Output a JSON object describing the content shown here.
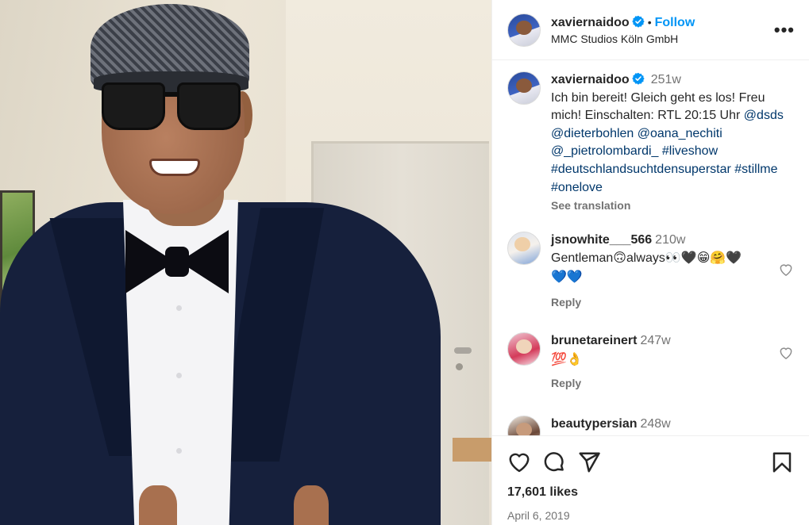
{
  "post": {
    "username": "xaviernaidoo",
    "separator": "•",
    "follow_label": "Follow",
    "location": "MMC Studios Köln GmbH",
    "more_label": "•••"
  },
  "caption": {
    "username": "xaviernaidoo",
    "time": "251w",
    "text": "Ich bin bereit! Gleich geht es los! Freu mich! Einschalten: RTL 20:15 Uhr",
    "mentions": "@dsds\n@dieterbohlen @oana_nechiti\n@_pietrolombardi_ #liveshow\n#deutschlandsuchtdensuperstar #stillme\n#onelove",
    "see_translation": "See translation"
  },
  "comments": [
    {
      "username": "jsnowhite___566",
      "time": "210w",
      "text_before": "Gentleman",
      "emoji1": "🙃",
      "text_after": "always",
      "emoji2": "👀🖤😁🤗🖤",
      "emoji3": "💙💙",
      "reply": "Reply"
    },
    {
      "username": "brunetareinert",
      "time": "247w",
      "emoji": "💯👌",
      "reply": "Reply"
    },
    {
      "username": "beautypersian",
      "time": "248w"
    }
  ],
  "footer": {
    "likes": "17,601 likes",
    "date": "April 6, 2019"
  },
  "colors": {
    "accent": "#0095f6",
    "verified": "#0095f6",
    "muted": "#737373",
    "link": "#00376b"
  },
  "icons": [
    "verified-badge-icon",
    "more-options-icon",
    "heart-icon",
    "comment-icon",
    "share-icon",
    "bookmark-icon"
  ]
}
